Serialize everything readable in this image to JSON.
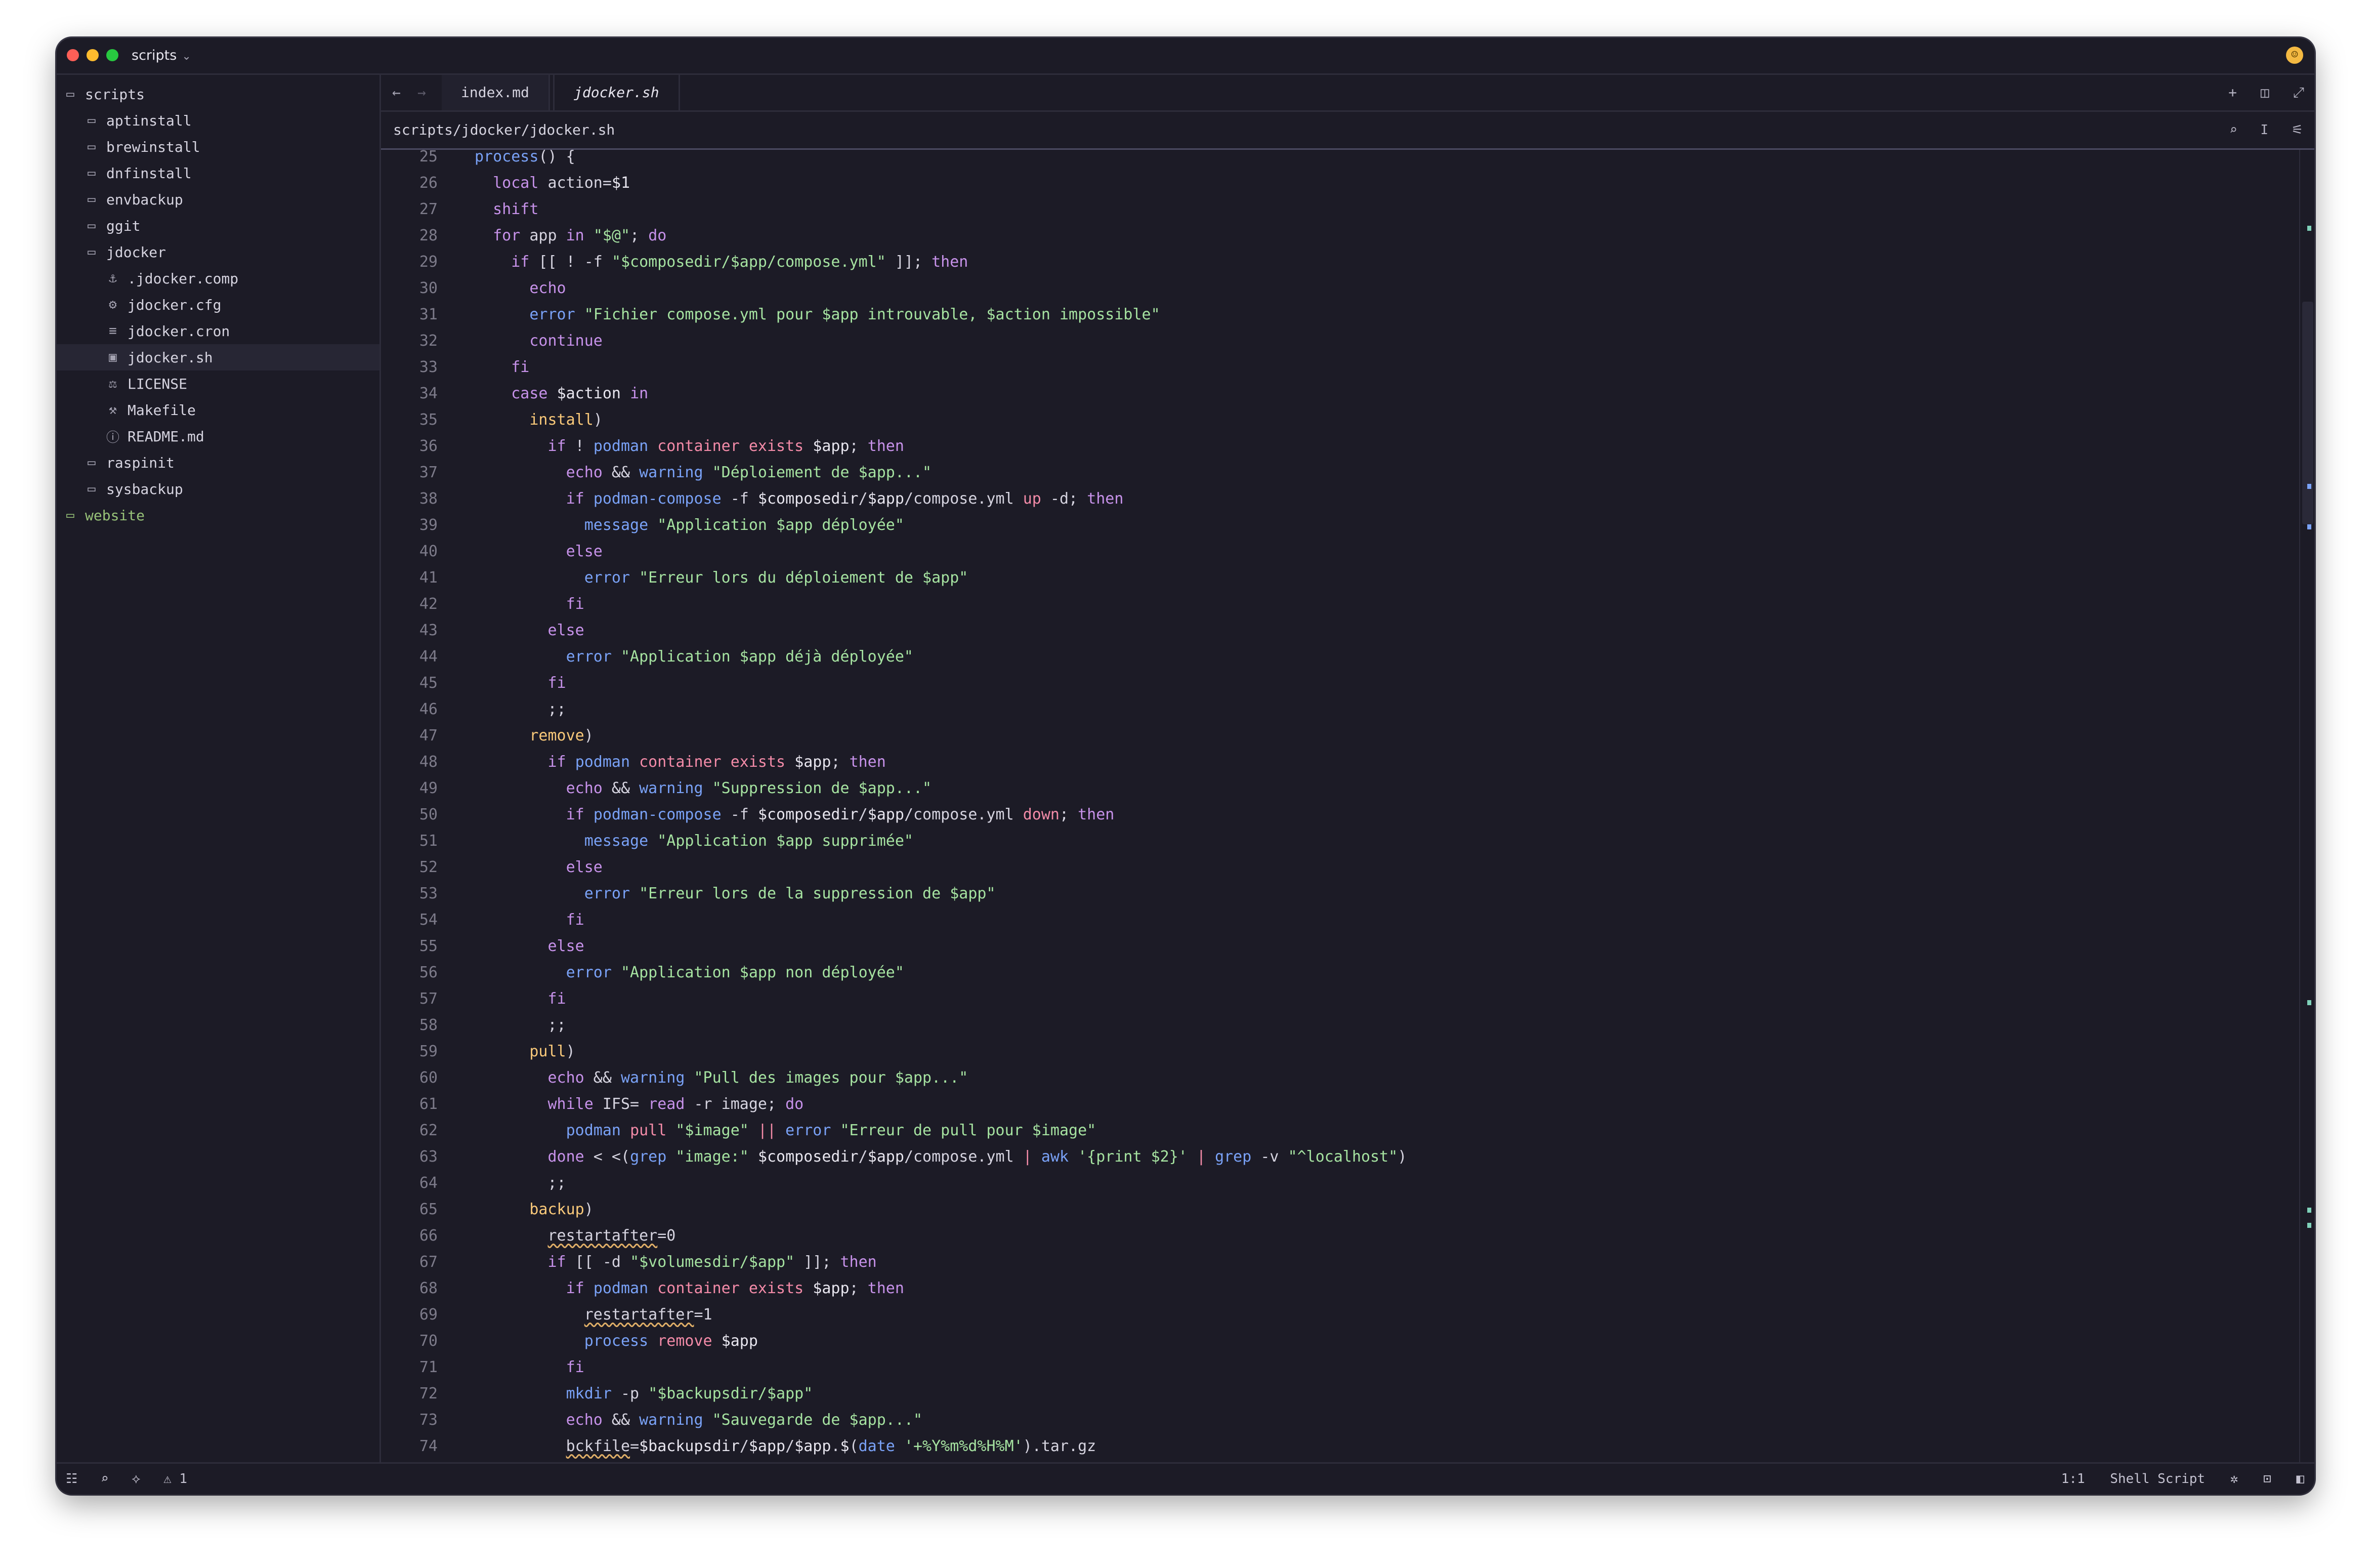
{
  "titlebar": {
    "project": "scripts",
    "chevron": "⌄"
  },
  "sidebar": {
    "items": [
      {
        "label": "scripts",
        "icon": "folder-open-icon",
        "glyph": "▭",
        "level": 0
      },
      {
        "label": "aptinstall",
        "icon": "folder-icon",
        "glyph": "▭",
        "level": 1
      },
      {
        "label": "brewinstall",
        "icon": "folder-icon",
        "glyph": "▭",
        "level": 1
      },
      {
        "label": "dnfinstall",
        "icon": "folder-icon",
        "glyph": "▭",
        "level": 1
      },
      {
        "label": "envbackup",
        "icon": "folder-icon",
        "glyph": "▭",
        "level": 1
      },
      {
        "label": "ggit",
        "icon": "folder-icon",
        "glyph": "▭",
        "level": 1
      },
      {
        "label": "jdocker",
        "icon": "folder-open-icon",
        "glyph": "▭",
        "level": 1
      },
      {
        "label": ".jdocker.comp",
        "icon": "docker-icon",
        "glyph": "⚓",
        "level": 2
      },
      {
        "label": "jdocker.cfg",
        "icon": "gear-icon",
        "glyph": "⚙",
        "level": 2
      },
      {
        "label": "jdocker.cron",
        "icon": "list-icon",
        "glyph": "≡",
        "level": 2
      },
      {
        "label": "jdocker.sh",
        "icon": "terminal-file-icon",
        "glyph": "▣",
        "level": 2,
        "selected": true
      },
      {
        "label": "LICENSE",
        "icon": "scale-icon",
        "glyph": "⚖",
        "level": 2
      },
      {
        "label": "Makefile",
        "icon": "hammer-icon",
        "glyph": "⚒",
        "level": 2
      },
      {
        "label": "README.md",
        "icon": "info-icon",
        "glyph": "ⓘ",
        "level": 2
      },
      {
        "label": "raspinit",
        "icon": "folder-icon",
        "glyph": "▭",
        "level": 1
      },
      {
        "label": "sysbackup",
        "icon": "folder-icon",
        "glyph": "▭",
        "level": 1
      },
      {
        "label": "website",
        "icon": "folder-modified-icon",
        "glyph": "▭",
        "level": 0,
        "green": true
      }
    ]
  },
  "tabs": {
    "back": "←",
    "forward": "→",
    "items": [
      {
        "label": "index.md",
        "active": false
      },
      {
        "label": "jdocker.sh",
        "active": true
      }
    ],
    "icons": {
      "add": "+",
      "split": "◫",
      "maximize": "⤢"
    }
  },
  "breadcrumb": {
    "path": "scripts/jdocker/jdocker.sh",
    "search": "⌕",
    "cursor": "I",
    "settings": "⚟"
  },
  "status": {
    "panel": "☷",
    "search": "⌕",
    "git": "⟡",
    "warnings": "⚠ 1",
    "position": "1:1",
    "language": "Shell Script",
    "ai": "✲",
    "terminal": "⊡",
    "layout": "◧"
  },
  "code": {
    "lines": [
      {
        "n": "25",
        "code": "process() {"
      },
      {
        "n": "26",
        "code": "  local action=$1"
      },
      {
        "n": "27",
        "code": "  shift"
      },
      {
        "n": "28",
        "code": "  for app in \"$@\"; do"
      },
      {
        "n": "29",
        "code": "    if [[ ! -f \"$composedir/$app/compose.yml\" ]]; then"
      },
      {
        "n": "30",
        "code": "      echo"
      },
      {
        "n": "31",
        "code": "      error \"Fichier compose.yml pour $app introuvable, $action impossible\""
      },
      {
        "n": "32",
        "code": "      continue"
      },
      {
        "n": "33",
        "code": "    fi"
      },
      {
        "n": "34",
        "code": "    case $action in"
      },
      {
        "n": "35",
        "code": "      install)"
      },
      {
        "n": "36",
        "code": "        if ! podman container exists $app; then"
      },
      {
        "n": "37",
        "code": "          echo && warning \"Déploiement de $app...\""
      },
      {
        "n": "38",
        "code": "          if podman-compose -f $composedir/$app/compose.yml up -d; then"
      },
      {
        "n": "39",
        "code": "            message \"Application $app déployée\""
      },
      {
        "n": "40",
        "code": "          else"
      },
      {
        "n": "41",
        "code": "            error \"Erreur lors du déploiement de $app\""
      },
      {
        "n": "42",
        "code": "          fi"
      },
      {
        "n": "43",
        "code": "        else"
      },
      {
        "n": "44",
        "code": "          error \"Application $app déjà déployée\""
      },
      {
        "n": "45",
        "code": "        fi"
      },
      {
        "n": "46",
        "code": "        ;;"
      },
      {
        "n": "47",
        "code": "      remove)"
      },
      {
        "n": "48",
        "code": "        if podman container exists $app; then"
      },
      {
        "n": "49",
        "code": "          echo && warning \"Suppression de $app...\""
      },
      {
        "n": "50",
        "code": "          if podman-compose -f $composedir/$app/compose.yml down; then"
      },
      {
        "n": "51",
        "code": "            message \"Application $app supprimée\""
      },
      {
        "n": "52",
        "code": "          else"
      },
      {
        "n": "53",
        "code": "            error \"Erreur lors de la suppression de $app\""
      },
      {
        "n": "54",
        "code": "          fi"
      },
      {
        "n": "55",
        "code": "        else"
      },
      {
        "n": "56",
        "code": "          error \"Application $app non déployée\""
      },
      {
        "n": "57",
        "code": "        fi"
      },
      {
        "n": "58",
        "code": "        ;;"
      },
      {
        "n": "59",
        "code": "      pull)"
      },
      {
        "n": "60",
        "code": "        echo && warning \"Pull des images pour $app...\""
      },
      {
        "n": "61",
        "code": "        while IFS= read -r image; do"
      },
      {
        "n": "62",
        "code": "          podman pull \"$image\" || error \"Erreur de pull pour $image\""
      },
      {
        "n": "63",
        "code": "        done < <(grep \"image:\" $composedir/$app/compose.yml | awk '{print $2}' | grep -v \"^localhost\")"
      },
      {
        "n": "64",
        "code": "        ;;"
      },
      {
        "n": "65",
        "code": "      backup)"
      },
      {
        "n": "66",
        "code": "        restartafter=0"
      },
      {
        "n": "67",
        "code": "        if [[ -d \"$volumesdir/$app\" ]]; then"
      },
      {
        "n": "68",
        "code": "          if podman container exists $app; then"
      },
      {
        "n": "69",
        "code": "            restartafter=1"
      },
      {
        "n": "70",
        "code": "            process remove $app"
      },
      {
        "n": "71",
        "code": "          fi"
      },
      {
        "n": "72",
        "code": "          mkdir -p \"$backupsdir/$app\""
      },
      {
        "n": "73",
        "code": "          echo && warning \"Sauvegarde de $app...\""
      },
      {
        "n": "74",
        "code": "          bckfile=$backupsdir/$app/$app.$(date '+%Y%m%d%H%M').tar.gz"
      }
    ]
  }
}
